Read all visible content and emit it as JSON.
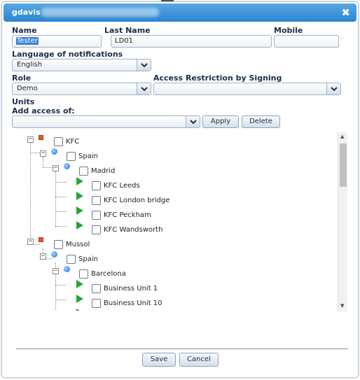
{
  "dialog": {
    "title": "gdavis",
    "close_label": "✖"
  },
  "form": {
    "name_label": "Name",
    "name_value": "Tester",
    "lastname_label": "Last Name",
    "lastname_value": "LD01",
    "mobile_label": "Mobile",
    "mobile_value": "",
    "language_label": "Language of notifications",
    "language_value": "English",
    "role_label": "Role",
    "role_value": "Demo",
    "restriction_label": "Access Restriction by Signing",
    "restriction_value": "",
    "units_label": "Units",
    "add_access_label": "Add access of:",
    "add_access_value": "",
    "apply_label": "Apply",
    "delete_label": "Delete"
  },
  "tree": {
    "nodes": [
      {
        "label": "KFC"
      },
      {
        "label": "Spain"
      },
      {
        "label": "Madrid"
      },
      {
        "label": "KFC Leeds"
      },
      {
        "label": "KFC London bridge"
      },
      {
        "label": "KFC Peckham"
      },
      {
        "label": "KFC Wandsworth"
      },
      {
        "label": "Mussol"
      },
      {
        "label": "Spain"
      },
      {
        "label": "Barcelona"
      },
      {
        "label": "Business Unit 1"
      },
      {
        "label": "Business Unit 10"
      }
    ]
  },
  "footer": {
    "save_label": "Save",
    "cancel_label": "Cancel"
  },
  "colors": {
    "titlebar": "#2b84cf",
    "company_marker": "#e55a2c",
    "region_marker": "#1a73d6",
    "unit_marker": "#2aa336"
  },
  "icons": {
    "dropdown": "chevron-down-icon",
    "close": "close-icon",
    "company": "company-square-icon",
    "region": "region-dot-icon",
    "unit": "unit-arrow-icon"
  }
}
